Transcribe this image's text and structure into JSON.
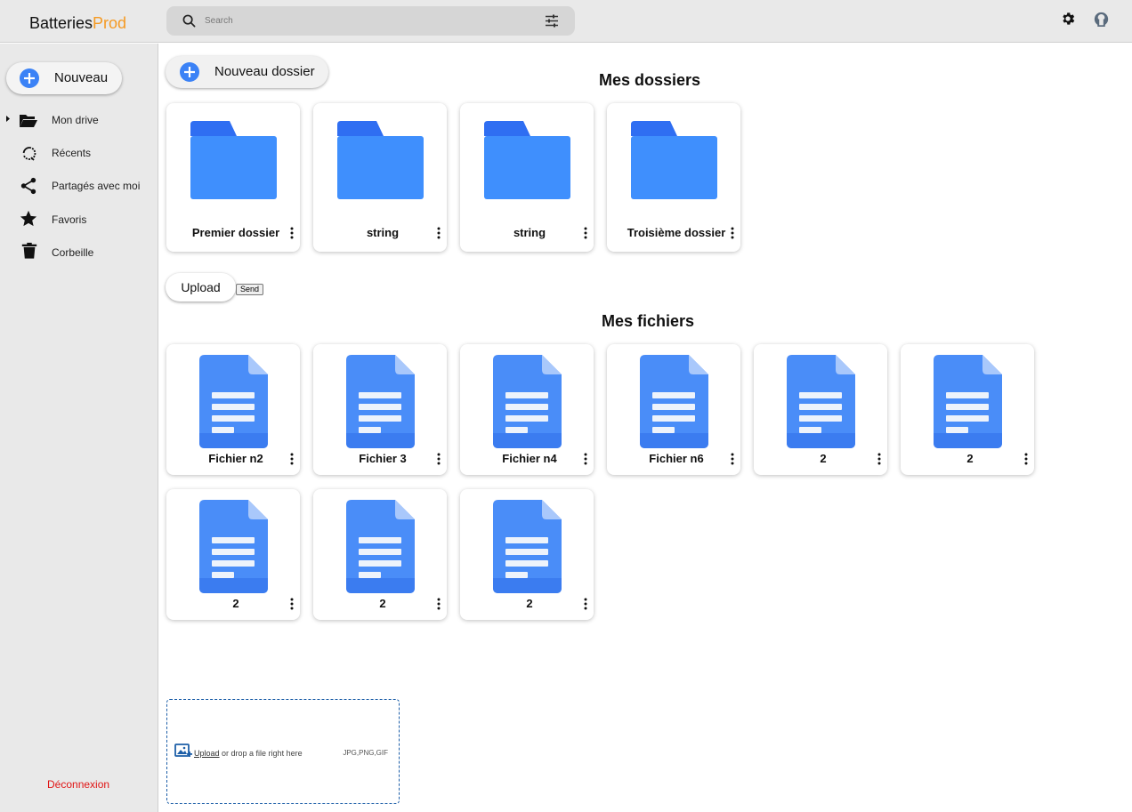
{
  "brand": {
    "part1": "Batteries",
    "part2": "Prod",
    "accent": "#f59a23"
  },
  "search": {
    "placeholder": "Search"
  },
  "sidebar": {
    "new_label": "Nouveau",
    "items": [
      {
        "label": "Mon drive",
        "icon": "folder-open-icon"
      },
      {
        "label": "Récents",
        "icon": "history-icon"
      },
      {
        "label": "Partagés avec moi",
        "icon": "share-icon"
      },
      {
        "label": "Favoris",
        "icon": "star-icon"
      },
      {
        "label": "Corbeille",
        "icon": "trash-icon"
      }
    ],
    "logout": "Déconnexion"
  },
  "main": {
    "new_folder_label": "Nouveau dossier",
    "folders_title": "Mes dossiers",
    "folders": [
      {
        "name": "Premier dossier"
      },
      {
        "name": "string"
      },
      {
        "name": "string"
      },
      {
        "name": "Troisième dossier"
      }
    ],
    "upload_label": "Upload",
    "send_label": "Send",
    "files_title": "Mes fichiers",
    "files": [
      {
        "name": "Fichier n2"
      },
      {
        "name": "Fichier 3"
      },
      {
        "name": "Fichier n4"
      },
      {
        "name": "Fichier n6"
      },
      {
        "name": "2"
      },
      {
        "name": "2"
      },
      {
        "name": "2"
      },
      {
        "name": "2"
      },
      {
        "name": "2"
      }
    ],
    "dropzone": {
      "link": "Upload",
      "text": " or drop a file right here",
      "types": "JPG,PNG,GIF"
    }
  },
  "colors": {
    "accent_blue": "#3b82f6",
    "logout_red": "#e01515"
  }
}
